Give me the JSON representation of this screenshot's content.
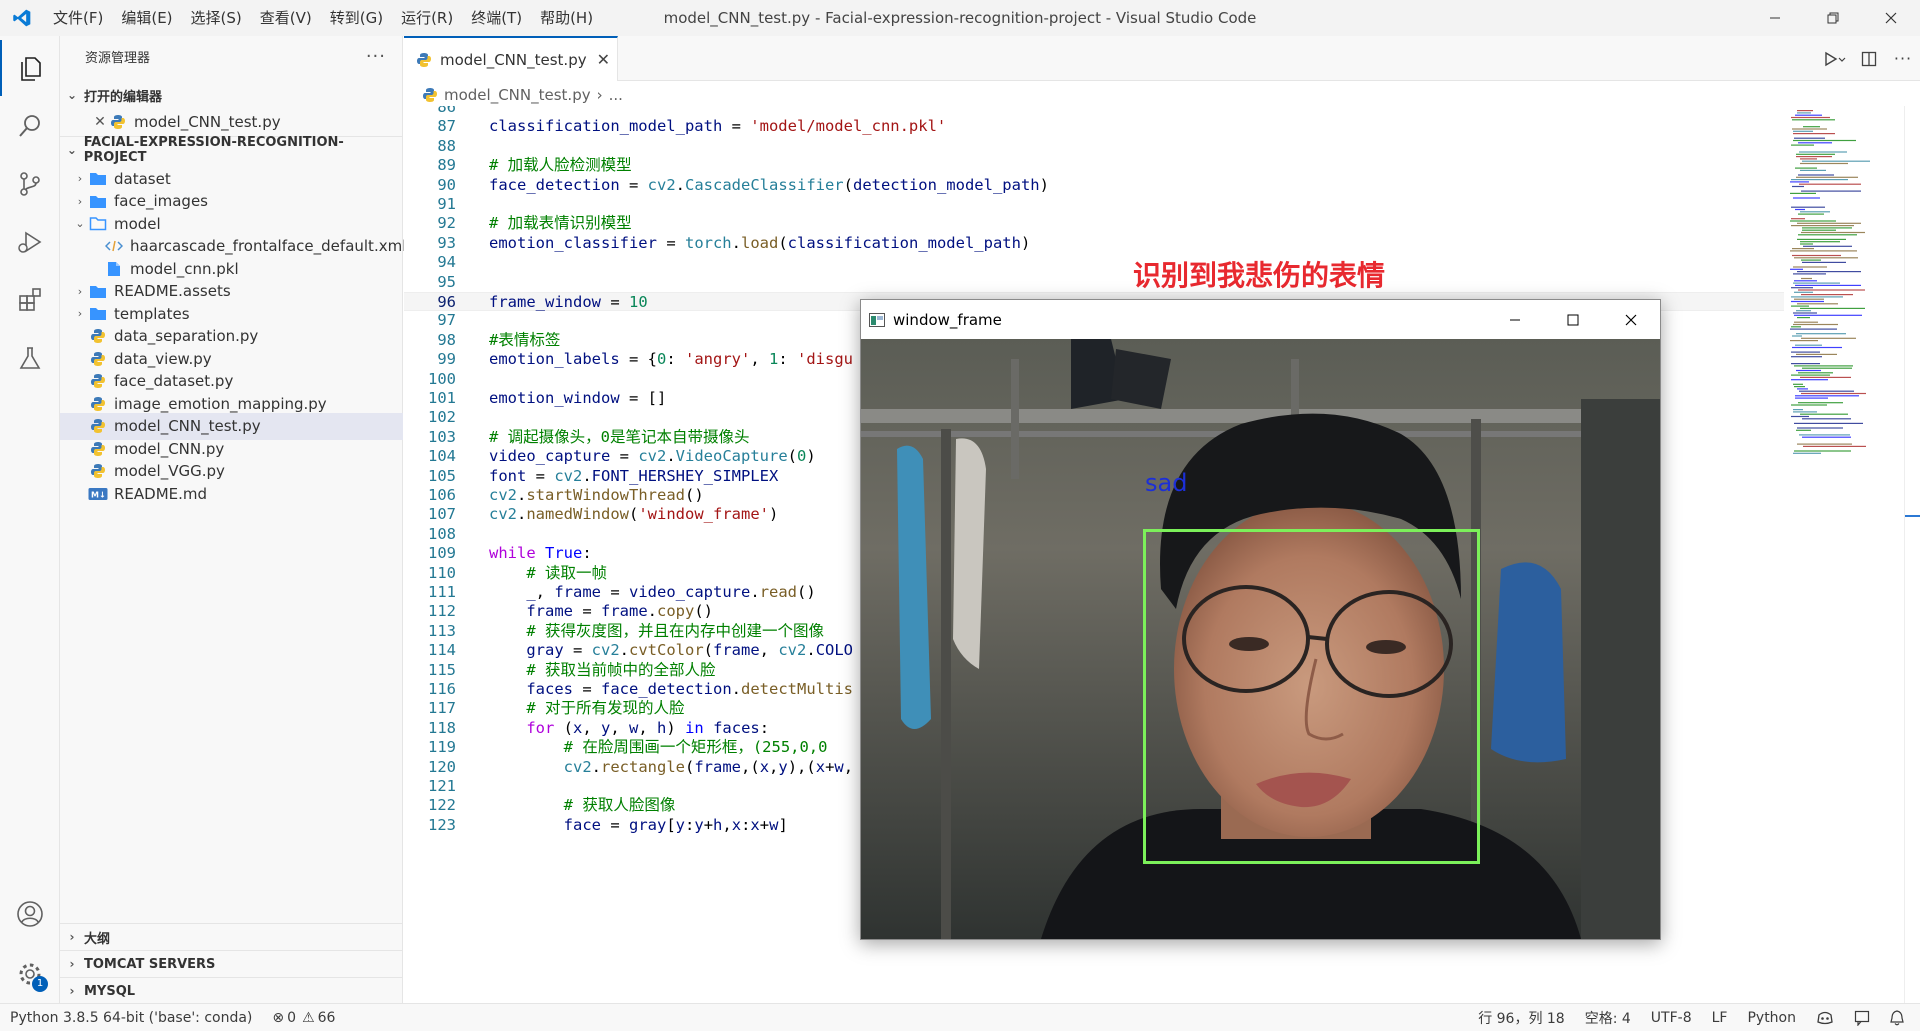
{
  "titlebar": {
    "menus": [
      "文件(F)",
      "编辑(E)",
      "选择(S)",
      "查看(V)",
      "转到(G)",
      "运行(R)",
      "终端(T)",
      "帮助(H)"
    ],
    "window_title": "model_CNN_test.py - Facial-expression-recognition-project - Visual Studio Code"
  },
  "activitybar": {
    "items": [
      "explorer-icon",
      "search-icon",
      "source-control-icon",
      "run-debug-icon",
      "extensions-icon",
      "testing-icon"
    ],
    "bottom": [
      "accounts-icon",
      "settings-icon"
    ],
    "settings_badge": "1"
  },
  "sidebar": {
    "title": "资源管理器",
    "more": "···",
    "open_editors_header": "打开的编辑器",
    "open_editors": [
      {
        "label": "model_CNN_test.py"
      }
    ],
    "project_header": "FACIAL-EXPRESSION-RECOGNITION-PROJECT",
    "tree": [
      {
        "label": "dataset",
        "kind": "folder",
        "expanded": false
      },
      {
        "label": "face_images",
        "kind": "folder",
        "expanded": false
      },
      {
        "label": "model",
        "kind": "folder",
        "expanded": true
      },
      {
        "label": "haarcascade_frontalface_default.xml",
        "kind": "xml"
      },
      {
        "label": "model_cnn.pkl",
        "kind": "file"
      },
      {
        "label": "README.assets",
        "kind": "folder",
        "expanded": false
      },
      {
        "label": "templates",
        "kind": "folder",
        "expanded": false
      },
      {
        "label": "data_separation.py",
        "kind": "python"
      },
      {
        "label": "data_view.py",
        "kind": "python"
      },
      {
        "label": "face_dataset.py",
        "kind": "python"
      },
      {
        "label": "image_emotion_mapping.py",
        "kind": "python"
      },
      {
        "label": "model_CNN_test.py",
        "kind": "python",
        "selected": true
      },
      {
        "label": "model_CNN.py",
        "kind": "python"
      },
      {
        "label": "model_VGG.py",
        "kind": "python"
      },
      {
        "label": "README.md",
        "kind": "markdown"
      }
    ],
    "footer_sections": [
      "大纲",
      "TOMCAT SERVERS",
      "MYSQL"
    ]
  },
  "editor": {
    "tab_label": "model_CNN_test.py",
    "breadcrumb_file": "model_CNN_test.py",
    "breadcrumb_rest": "...",
    "current_line": "96",
    "lines": [
      {
        "n": "86",
        "t": []
      },
      {
        "n": "87",
        "t": [
          [
            "t-var",
            "classification_model_path"
          ],
          [
            "t-op",
            " = "
          ],
          [
            "t-str",
            "'model/model_cnn.pkl'"
          ]
        ]
      },
      {
        "n": "88",
        "t": []
      },
      {
        "n": "89",
        "t": [
          [
            "t-cm",
            "# 加载人脸检测模型"
          ]
        ]
      },
      {
        "n": "90",
        "t": [
          [
            "t-var",
            "face_detection"
          ],
          [
            "t-op",
            " = "
          ],
          [
            "t-mod",
            "cv2"
          ],
          [
            "t-op",
            "."
          ],
          [
            "t-mod",
            "CascadeClassifier"
          ],
          [
            "t-op",
            "("
          ],
          [
            "t-var",
            "detection_model_path"
          ],
          [
            "t-op",
            ")"
          ]
        ]
      },
      {
        "n": "91",
        "t": []
      },
      {
        "n": "92",
        "t": [
          [
            "t-cm",
            "# 加载表情识别模型"
          ]
        ]
      },
      {
        "n": "93",
        "t": [
          [
            "t-var",
            "emotion_classifier"
          ],
          [
            "t-op",
            " = "
          ],
          [
            "t-mod",
            "torch"
          ],
          [
            "t-op",
            "."
          ],
          [
            "t-m",
            "load"
          ],
          [
            "t-op",
            "("
          ],
          [
            "t-var",
            "classification_model_path"
          ],
          [
            "t-op",
            ")"
          ]
        ]
      },
      {
        "n": "94",
        "t": []
      },
      {
        "n": "95",
        "t": []
      },
      {
        "n": "96",
        "t": [
          [
            "t-var",
            "frame_window"
          ],
          [
            "t-op",
            " = "
          ],
          [
            "t-num",
            "10"
          ]
        ]
      },
      {
        "n": "97",
        "t": []
      },
      {
        "n": "98",
        "t": [
          [
            "t-cm",
            "#表情标签"
          ]
        ]
      },
      {
        "n": "99",
        "t": [
          [
            "t-var",
            "emotion_labels"
          ],
          [
            "t-op",
            " = {"
          ],
          [
            "t-num",
            "0"
          ],
          [
            "t-op",
            ": "
          ],
          [
            "t-str",
            "'angry'"
          ],
          [
            "t-op",
            ", "
          ],
          [
            "t-num",
            "1"
          ],
          [
            "t-op",
            ": "
          ],
          [
            "t-str",
            "'disgu"
          ]
        ]
      },
      {
        "n": "100",
        "t": []
      },
      {
        "n": "101",
        "t": [
          [
            "t-var",
            "emotion_window"
          ],
          [
            "t-op",
            " = []"
          ]
        ]
      },
      {
        "n": "102",
        "t": []
      },
      {
        "n": "103",
        "t": [
          [
            "t-cm",
            "# 调起摄像头，0是笔记本自带摄像头"
          ]
        ]
      },
      {
        "n": "104",
        "t": [
          [
            "t-var",
            "video_capture"
          ],
          [
            "t-op",
            " = "
          ],
          [
            "t-mod",
            "cv2"
          ],
          [
            "t-op",
            "."
          ],
          [
            "t-mod",
            "VideoCapture"
          ],
          [
            "t-op",
            "("
          ],
          [
            "t-num",
            "0"
          ],
          [
            "t-op",
            ")"
          ]
        ]
      },
      {
        "n": "105",
        "t": [
          [
            "t-var",
            "font"
          ],
          [
            "t-op",
            " = "
          ],
          [
            "t-mod",
            "cv2"
          ],
          [
            "t-op",
            "."
          ],
          [
            "t-var",
            "FONT_HERSHEY_SIMPLEX"
          ]
        ]
      },
      {
        "n": "106",
        "t": [
          [
            "t-mod",
            "cv2"
          ],
          [
            "t-op",
            "."
          ],
          [
            "t-fn",
            "startWindowThread"
          ],
          [
            "t-op",
            "()"
          ]
        ]
      },
      {
        "n": "107",
        "t": [
          [
            "t-mod",
            "cv2"
          ],
          [
            "t-op",
            "."
          ],
          [
            "t-fn",
            "namedWindow"
          ],
          [
            "t-op",
            "("
          ],
          [
            "t-str",
            "'window_frame'"
          ],
          [
            "t-op",
            ")"
          ]
        ]
      },
      {
        "n": "108",
        "t": []
      },
      {
        "n": "109",
        "t": [
          [
            "t-ctl",
            "while"
          ],
          [
            "t-op",
            " "
          ],
          [
            "t-kw",
            "True"
          ],
          [
            "t-op",
            ":"
          ]
        ]
      },
      {
        "n": "110",
        "t": [
          [
            "t-op",
            "    "
          ],
          [
            "t-cm",
            "# 读取一帧"
          ]
        ]
      },
      {
        "n": "111",
        "t": [
          [
            "t-op",
            "    "
          ],
          [
            "t-var",
            "_"
          ],
          [
            "t-op",
            ", "
          ],
          [
            "t-var",
            "frame"
          ],
          [
            "t-op",
            " = "
          ],
          [
            "t-var",
            "video_capture"
          ],
          [
            "t-op",
            "."
          ],
          [
            "t-m",
            "read"
          ],
          [
            "t-op",
            "()"
          ]
        ]
      },
      {
        "n": "112",
        "t": [
          [
            "t-op",
            "    "
          ],
          [
            "t-var",
            "frame"
          ],
          [
            "t-op",
            " = "
          ],
          [
            "t-var",
            "frame"
          ],
          [
            "t-op",
            "."
          ],
          [
            "t-m",
            "copy"
          ],
          [
            "t-op",
            "()"
          ]
        ]
      },
      {
        "n": "113",
        "t": [
          [
            "t-op",
            "    "
          ],
          [
            "t-cm",
            "# 获得灰度图，并且在内存中创建一个图像"
          ]
        ]
      },
      {
        "n": "114",
        "t": [
          [
            "t-op",
            "    "
          ],
          [
            "t-var",
            "gray"
          ],
          [
            "t-op",
            " = "
          ],
          [
            "t-mod",
            "cv2"
          ],
          [
            "t-op",
            "."
          ],
          [
            "t-fn",
            "cvtColor"
          ],
          [
            "t-op",
            "("
          ],
          [
            "t-var",
            "frame"
          ],
          [
            "t-op",
            ", "
          ],
          [
            "t-mod",
            "cv2"
          ],
          [
            "t-op",
            "."
          ],
          [
            "t-var",
            "COLO"
          ]
        ]
      },
      {
        "n": "115",
        "t": [
          [
            "t-op",
            "    "
          ],
          [
            "t-cm",
            "# 获取当前帧中的全部人脸"
          ]
        ]
      },
      {
        "n": "116",
        "t": [
          [
            "t-op",
            "    "
          ],
          [
            "t-var",
            "faces"
          ],
          [
            "t-op",
            " = "
          ],
          [
            "t-var",
            "face_detection"
          ],
          [
            "t-op",
            "."
          ],
          [
            "t-m",
            "detectMultis"
          ]
        ]
      },
      {
        "n": "117",
        "t": [
          [
            "t-op",
            "    "
          ],
          [
            "t-cm",
            "# 对于所有发现的人脸"
          ]
        ]
      },
      {
        "n": "118",
        "t": [
          [
            "t-op",
            "    "
          ],
          [
            "t-ctl",
            "for"
          ],
          [
            "t-op",
            " ("
          ],
          [
            "t-var",
            "x"
          ],
          [
            "t-op",
            ", "
          ],
          [
            "t-var",
            "y"
          ],
          [
            "t-op",
            ", "
          ],
          [
            "t-var",
            "w"
          ],
          [
            "t-op",
            ", "
          ],
          [
            "t-var",
            "h"
          ],
          [
            "t-op",
            ") "
          ],
          [
            "t-kw",
            "in"
          ],
          [
            "t-op",
            " "
          ],
          [
            "t-var",
            "faces"
          ],
          [
            "t-op",
            ":"
          ]
        ]
      },
      {
        "n": "119",
        "t": [
          [
            "t-op",
            "        "
          ],
          [
            "t-cm",
            "# 在脸周围画一个矩形框，(255,0,0"
          ]
        ]
      },
      {
        "n": "120",
        "t": [
          [
            "t-op",
            "        "
          ],
          [
            "t-mod",
            "cv2"
          ],
          [
            "t-op",
            "."
          ],
          [
            "t-fn",
            "rectangle"
          ],
          [
            "t-op",
            "("
          ],
          [
            "t-var",
            "frame"
          ],
          [
            "t-op",
            ",("
          ],
          [
            "t-var",
            "x"
          ],
          [
            "t-op",
            ","
          ],
          [
            "t-var",
            "y"
          ],
          [
            "t-op",
            "),("
          ],
          [
            "t-var",
            "x"
          ],
          [
            "t-op",
            "+"
          ],
          [
            "t-var",
            "w"
          ],
          [
            "t-op",
            ","
          ]
        ]
      },
      {
        "n": "121",
        "t": []
      },
      {
        "n": "122",
        "t": [
          [
            "t-op",
            "        "
          ],
          [
            "t-cm",
            "# 获取人脸图像"
          ]
        ]
      },
      {
        "n": "123",
        "t": [
          [
            "t-op",
            "        "
          ],
          [
            "t-var",
            "face"
          ],
          [
            "t-op",
            " = "
          ],
          [
            "t-var",
            "gray"
          ],
          [
            "t-op",
            "["
          ],
          [
            "t-var",
            "y"
          ],
          [
            "t-op",
            ":"
          ],
          [
            "t-var",
            "y"
          ],
          [
            "t-op",
            "+"
          ],
          [
            "t-var",
            "h"
          ],
          [
            "t-op",
            ","
          ],
          [
            "t-var",
            "x"
          ],
          [
            "t-op",
            ":"
          ],
          [
            "t-var",
            "x"
          ],
          [
            "t-op",
            "+"
          ],
          [
            "t-var",
            "w"
          ],
          [
            "t-op",
            "]"
          ]
        ]
      }
    ]
  },
  "annotation": "识别到我悲伤的表情",
  "cv_window": {
    "title": "window_frame",
    "emotion_label": "sad",
    "box_color": "#7cf05a",
    "label_color": "#1c2fd8"
  },
  "statusbar": {
    "interpreter": "Python 3.8.5 64-bit ('base': conda)",
    "errors": "0",
    "warnings": "66",
    "position": "行 96，列 18",
    "spaces": "空格: 4",
    "encoding": "UTF-8",
    "eol": "LF",
    "language": "Python"
  },
  "colors": {
    "accent": "#005fb8",
    "annotation": "#e8292f"
  }
}
